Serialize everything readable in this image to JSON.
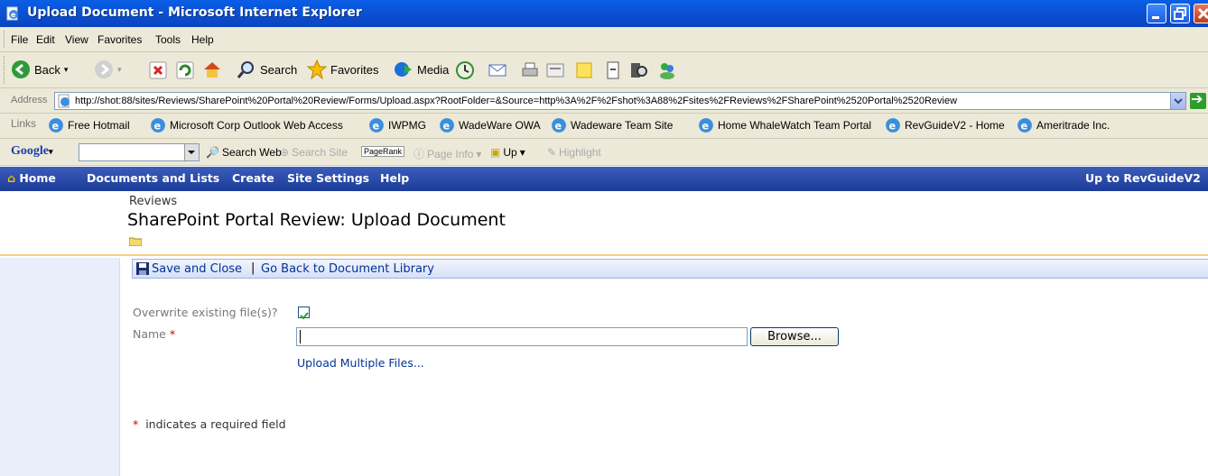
{
  "window": {
    "title": "Upload Document - Microsoft Internet Explorer"
  },
  "menu": [
    "File",
    "Edit",
    "View",
    "Favorites",
    "Tools",
    "Help"
  ],
  "toolbar": {
    "back": "Back",
    "search": "Search",
    "favorites": "Favorites",
    "media": "Media"
  },
  "address": {
    "label": "Address",
    "url": "http://shot:88/sites/Reviews/SharePoint%20Portal%20Review/Forms/Upload.aspx?RootFolder=&Source=http%3A%2F%2Fshot%3A88%2Fsites%2FReviews%2FSharePoint%2520Portal%2520Review"
  },
  "links": {
    "label": "Links",
    "items": [
      "Free Hotmail",
      "Microsoft Corp Outlook Web Access",
      "IWPMG",
      "WadeWare OWA",
      "Wadeware Team Site",
      "Home WhaleWatch Team Portal",
      "RevGuideV2 - Home",
      "Ameritrade Inc."
    ]
  },
  "google": {
    "logo": "Google",
    "search_web": "Search Web",
    "search_site": "Search Site",
    "pagerank": "PageRank",
    "page_info": "Page Info",
    "up": "Up",
    "highlight": "Highlight"
  },
  "spnav": {
    "items": [
      "Home",
      "Documents and Lists",
      "Create",
      "Site Settings",
      "Help"
    ],
    "up_to": "Up to RevGuideV2"
  },
  "header": {
    "site": "Reviews",
    "title": "SharePoint Portal Review: Upload Document"
  },
  "commands": {
    "save_close": "Save and Close",
    "separator": "|",
    "go_back": "Go Back to Document Library"
  },
  "form": {
    "overwrite_label": "Overwrite existing file(s)?",
    "overwrite_checked": true,
    "name_label": "Name",
    "required_mark": "*",
    "name_value": "",
    "browse": "Browse...",
    "upload_multiple": "Upload Multiple Files...",
    "required_note": "indicates a required field"
  },
  "colors": {
    "title_bar": "#0b50d3",
    "sp_nav": "#2a4aa8",
    "link": "#003399",
    "required": "#cc0000",
    "header_border": "#f7d27c"
  }
}
